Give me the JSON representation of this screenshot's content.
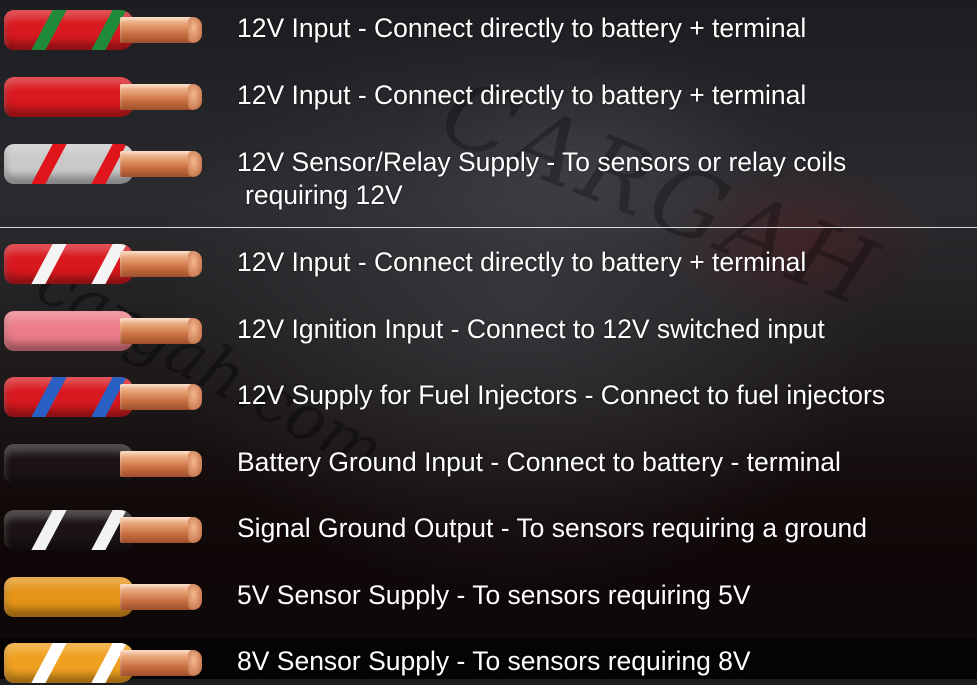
{
  "watermark": {
    "brand": "CARGAH",
    "url": "cargah.com"
  },
  "wires": [
    {
      "id": "red-green",
      "insulation": "#d8191f",
      "stripe": "#1f8a3a",
      "label": "12V Input - Connect directly to battery + terminal",
      "label2": ""
    },
    {
      "id": "red",
      "insulation": "#d8191f",
      "stripe": "",
      "label": "12V Input - Connect directly to battery + terminal",
      "label2": ""
    },
    {
      "id": "gray-red",
      "insulation": "#c9c9c9",
      "stripe": "#e0151b",
      "label": "12V Sensor/Relay Supply - To sensors or relay coils",
      "label2": "requiring 12V"
    },
    {
      "id": "red-white",
      "insulation": "#d8191f",
      "stripe": "#f4f4f4",
      "label": "12V Input - Connect directly to battery + terminal",
      "label2": ""
    },
    {
      "id": "pink",
      "insulation": "#ec7d8a",
      "stripe": "",
      "label": "12V Ignition Input - Connect to 12V switched input",
      "label2": ""
    },
    {
      "id": "red-blue",
      "insulation": "#d8191f",
      "stripe": "#2a5fc4",
      "label": "12V Supply for Fuel Injectors - Connect to fuel injectors",
      "label2": ""
    },
    {
      "id": "black",
      "insulation": "#1c1414",
      "stripe": "",
      "label": "Battery Ground Input - Connect to battery - terminal",
      "label2": ""
    },
    {
      "id": "black-white",
      "insulation": "#1c1414",
      "stripe": "#f2f2f2",
      "label": "Signal Ground Output - To sensors requiring a ground",
      "label2": ""
    },
    {
      "id": "orange",
      "insulation": "#e59418",
      "stripe": "",
      "label": "5V Sensor Supply - To sensors requiring 5V",
      "label2": ""
    },
    {
      "id": "orange-white",
      "insulation": "#f0a020",
      "stripe": "#ffffff",
      "label": "8V Sensor Supply - To sensors requiring 8V",
      "label2": ""
    }
  ]
}
